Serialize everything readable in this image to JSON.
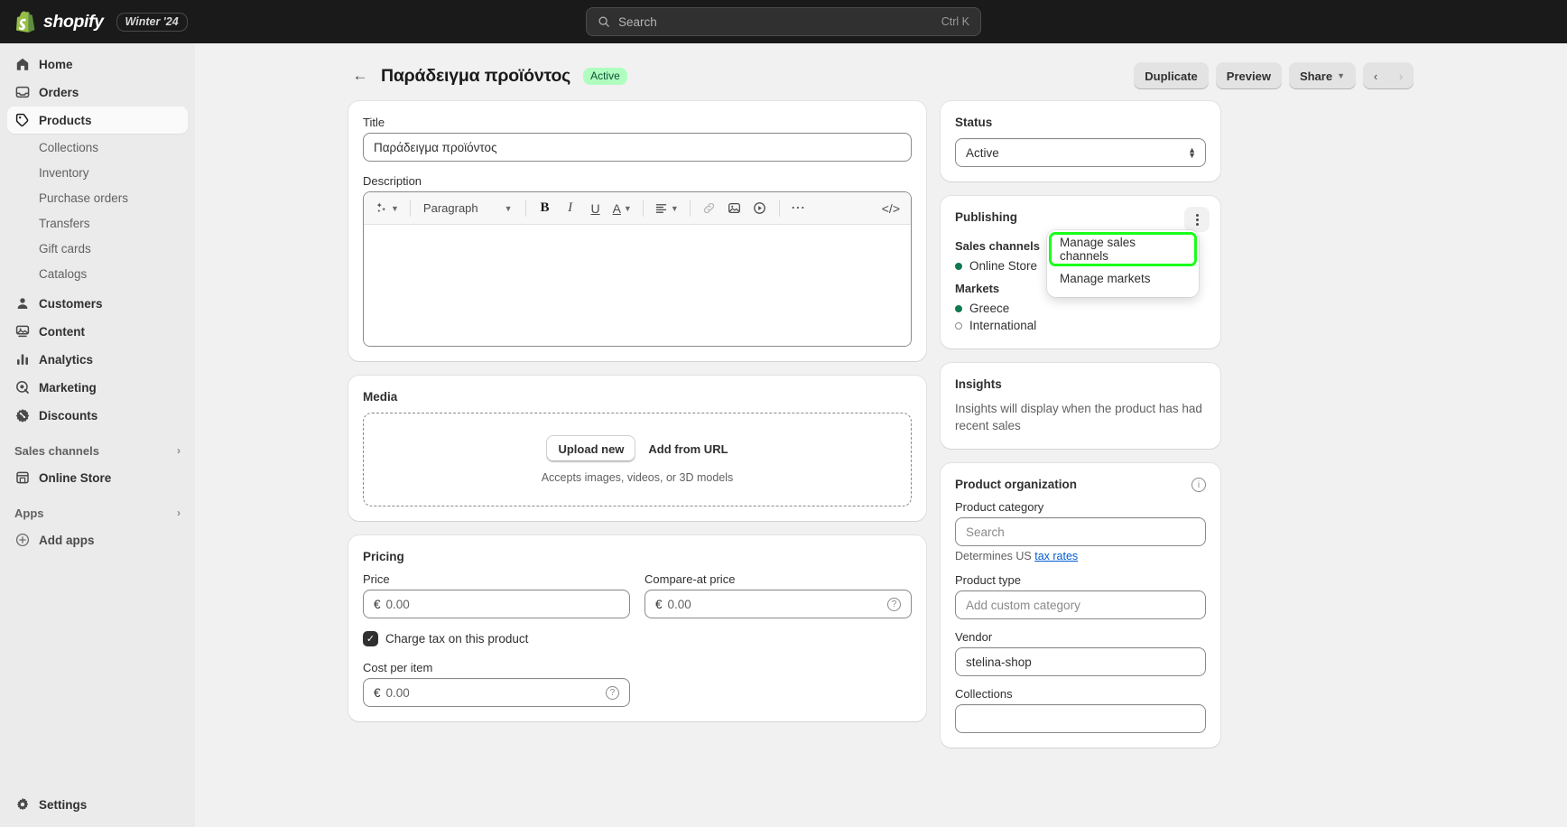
{
  "topbar": {
    "brand_name": "shopify",
    "season_badge": "Winter '24",
    "search_placeholder": "Search",
    "search_shortcut": "Ctrl K"
  },
  "sidebar": {
    "items": [
      {
        "label": "Home",
        "icon": "home-icon"
      },
      {
        "label": "Orders",
        "icon": "orders-icon"
      },
      {
        "label": "Products",
        "icon": "products-icon",
        "active": true
      }
    ],
    "product_subitems": [
      {
        "label": "Collections"
      },
      {
        "label": "Inventory"
      },
      {
        "label": "Purchase orders"
      },
      {
        "label": "Transfers"
      },
      {
        "label": "Gift cards"
      },
      {
        "label": "Catalogs"
      }
    ],
    "items_lower": [
      {
        "label": "Customers",
        "icon": "customers-icon"
      },
      {
        "label": "Content",
        "icon": "content-icon"
      },
      {
        "label": "Analytics",
        "icon": "analytics-icon"
      },
      {
        "label": "Marketing",
        "icon": "marketing-icon"
      },
      {
        "label": "Discounts",
        "icon": "discounts-icon"
      }
    ],
    "sales_channels_section": "Sales channels",
    "online_store": "Online Store",
    "apps_section": "Apps",
    "add_apps": "Add apps",
    "settings": "Settings"
  },
  "page_header": {
    "title": "Παράδειγμα προϊόντος",
    "status_badge": "Active",
    "duplicate": "Duplicate",
    "preview": "Preview",
    "share": "Share"
  },
  "title_card": {
    "label": "Title",
    "value": "Παράδειγμα προϊόντος"
  },
  "description_card": {
    "label": "Description",
    "toolbar": {
      "paragraph": "Paragraph"
    }
  },
  "media": {
    "title": "Media",
    "upload_new": "Upload new",
    "add_from_url": "Add from URL",
    "hint": "Accepts images, videos, or 3D models"
  },
  "pricing": {
    "title": "Pricing",
    "price_label": "Price",
    "price_currency": "€",
    "price_value": "0.00",
    "compare_label": "Compare-at price",
    "compare_currency": "€",
    "compare_value": "0.00",
    "charge_tax": "Charge tax on this product",
    "cost_label": "Cost per item",
    "cost_currency": "€",
    "cost_value": "0.00"
  },
  "status_card": {
    "title": "Status",
    "value": "Active"
  },
  "publishing": {
    "title": "Publishing",
    "sales_channels_label": "Sales channels",
    "channels": [
      {
        "label": "Online Store",
        "state": "on"
      }
    ],
    "markets_label": "Markets",
    "markets": [
      {
        "label": "Greece",
        "state": "on"
      },
      {
        "label": "International",
        "state": "off"
      }
    ],
    "menu": [
      {
        "label": "Manage sales channels",
        "highlighted": true
      },
      {
        "label": "Manage markets",
        "highlighted": false
      }
    ]
  },
  "insights": {
    "title": "Insights",
    "body": "Insights will display when the product has had recent sales"
  },
  "product_organization": {
    "title": "Product organization",
    "category_label": "Product category",
    "category_placeholder": "Search",
    "determines_prefix": "Determines US",
    "determines_link": "tax rates",
    "type_label": "Product type",
    "type_placeholder": "Add custom category",
    "vendor_label": "Vendor",
    "vendor_value": "stelina-shop",
    "collections_label": "Collections",
    "collections_value": ""
  },
  "colors": {
    "accent": "#005bd3",
    "highlight": "#1aff1a",
    "badge_bg": "#affebf",
    "badge_fg": "#0c5132",
    "channel_on": "#0f7a4f"
  }
}
